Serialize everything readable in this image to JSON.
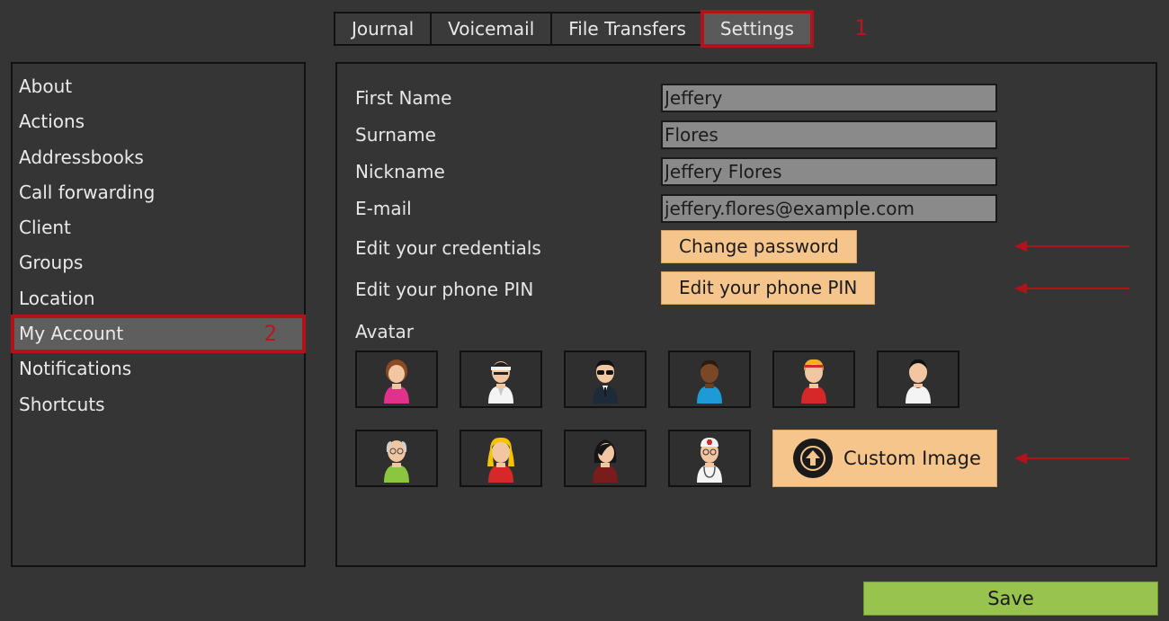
{
  "tabs": [
    {
      "label": "Journal",
      "active": false
    },
    {
      "label": "Voicemail",
      "active": false
    },
    {
      "label": "File Transfers",
      "active": false
    },
    {
      "label": "Settings",
      "active": true
    }
  ],
  "annotations": {
    "tab_number": "1",
    "sidebar_number": "2",
    "highlight_color": "#b4121b"
  },
  "sidebar": {
    "items": [
      {
        "label": "About"
      },
      {
        "label": "Actions"
      },
      {
        "label": "Addressbooks"
      },
      {
        "label": "Call forwarding"
      },
      {
        "label": "Client"
      },
      {
        "label": "Groups"
      },
      {
        "label": "Location"
      },
      {
        "label": "My Account",
        "selected": true
      },
      {
        "label": "Notifications"
      },
      {
        "label": "Shortcuts"
      }
    ]
  },
  "account": {
    "first_name": {
      "label": "First Name",
      "value": "Jeffery"
    },
    "surname": {
      "label": "Surname",
      "value": "Flores"
    },
    "nickname": {
      "label": "Nickname",
      "value": "Jeffery Flores"
    },
    "email": {
      "label": "E-mail",
      "value": "jeffery.flores@example.com"
    },
    "credentials": {
      "label": "Edit your credentials",
      "button": "Change password"
    },
    "pin": {
      "label": "Edit your phone PIN",
      "button": "Edit your phone PIN"
    },
    "avatar": {
      "label": "Avatar",
      "custom_button": "Custom Image",
      "options": [
        "avatar-woman-pink-icon",
        "avatar-karate-headband-icon",
        "avatar-man-sunglasses-suit-icon",
        "avatar-man-blue-shirt-icon",
        "avatar-woman-red-headband-icon",
        "avatar-man-white-shirt-icon",
        "avatar-elderly-man-icon",
        "avatar-woman-blonde-icon",
        "avatar-woman-dark-hair-icon",
        "avatar-doctor-icon"
      ]
    }
  },
  "footer": {
    "save_label": "Save"
  },
  "colors": {
    "background": "#353535",
    "input_bg": "#8a8a8a",
    "peach_button": "#f5c58c",
    "save_green": "#98c34f",
    "annotation_red": "#b4121b"
  }
}
